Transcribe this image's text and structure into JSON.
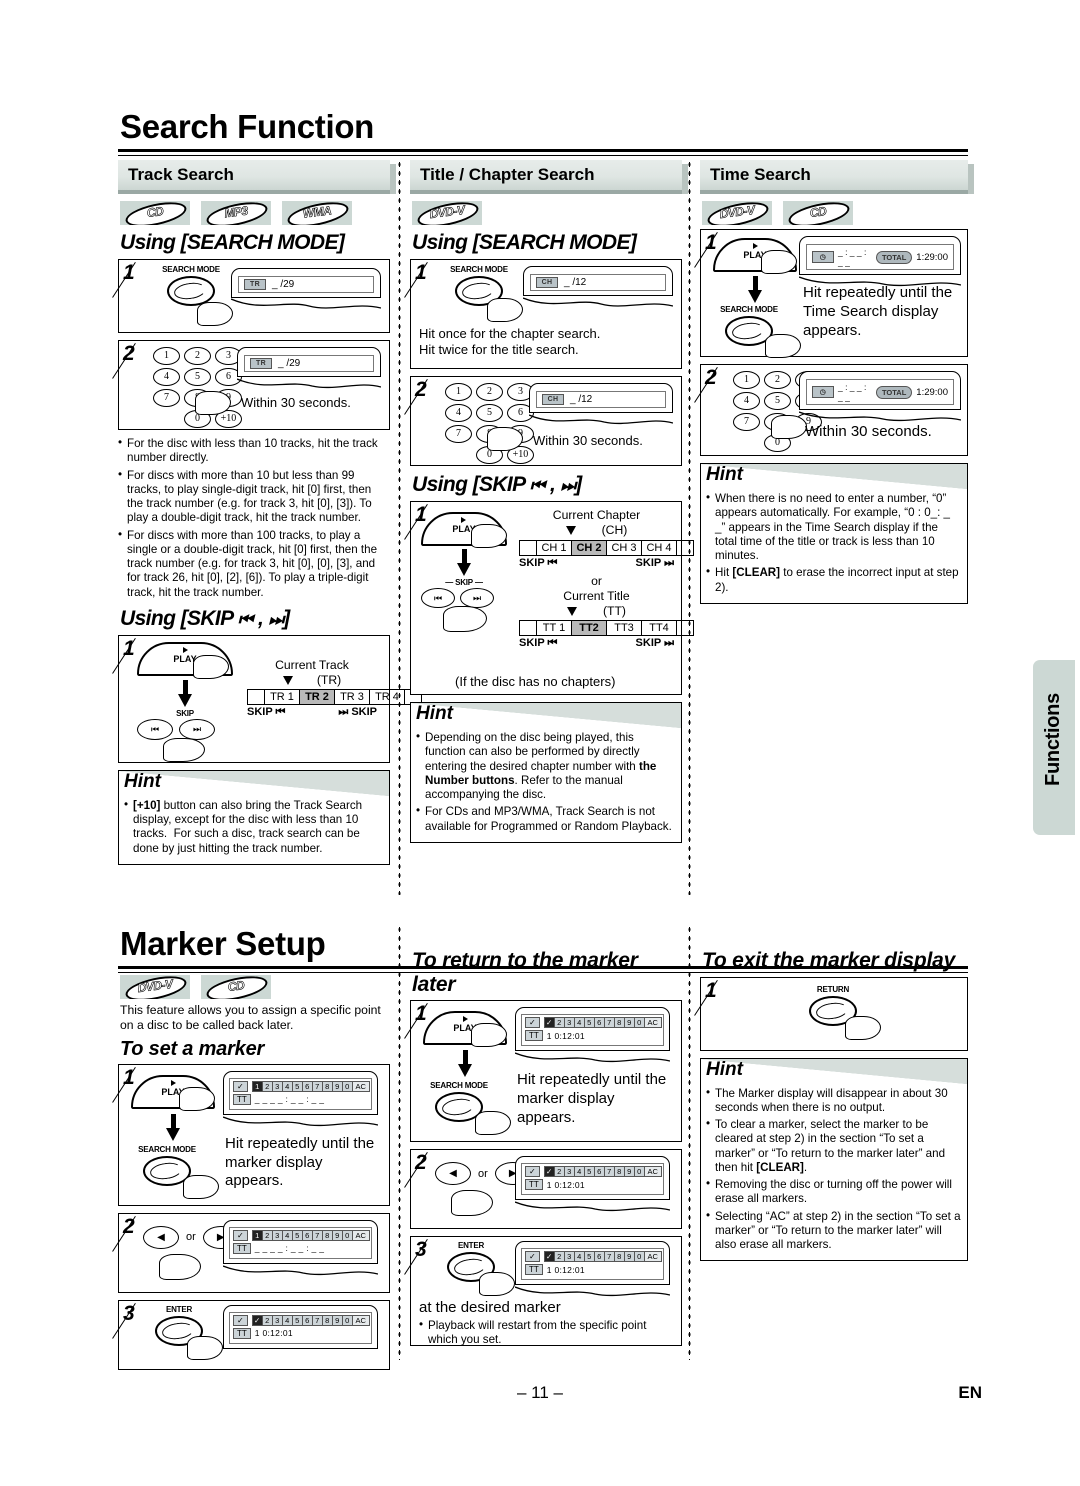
{
  "page": {
    "headings": {
      "search_function": "Search Function",
      "marker_setup": "Marker Setup"
    },
    "side_tab": "Functions",
    "footer": {
      "page_number": "– 11 –",
      "language": "EN"
    },
    "accent_color": "#ccd8d4",
    "rule_color": "#9aa8a4"
  },
  "track_search": {
    "title": "Track Search",
    "discs": [
      "CD",
      "MP3",
      "WMA"
    ],
    "using_search_mode": "Using [SEARCH MODE]",
    "using_skip": "Using [SKIP",
    "using_skip_end": "]",
    "step1": {
      "num": "1",
      "button": "SEARCH MODE",
      "display": {
        "tag": "TR",
        "value": "_ /29"
      }
    },
    "step2": {
      "num": "2",
      "keys": [
        "1",
        "2",
        "3",
        "4",
        "5",
        "6",
        "7",
        "8",
        "9",
        "0",
        "+10"
      ],
      "display": {
        "tag": "TR",
        "value": "_ /29"
      },
      "caption": "Within 30 seconds."
    },
    "notes": [
      "For the disc with less than 10 tracks, hit the track number directly.",
      "For discs with more than 10 but less than 99 tracks, to play single-digit track, hit [0] first, then the track number (e.g. for track 3, hit [0], [3]). To play a double-digit track, hit the track number.",
      "For discs with more than 100 tracks, to play a single or a double-digit track, hit [0] first, then the track number (e.g. for track 3, hit [0], [0], [3], and for track 26, hit [0], [2], [6]). To play a triple-digit track, hit the track number."
    ],
    "skip_step": {
      "num": "1",
      "play_label": "PLAY",
      "skip_label": "SKIP",
      "current_label": "Current Track",
      "current_unit": "(TR)",
      "segments": [
        "TR 1",
        "TR 2",
        "TR 3",
        "TR 4"
      ],
      "current_index": 1,
      "skip_prev": "SKIP",
      "skip_next": "SKIP"
    },
    "hint": {
      "title": "Hint",
      "items": [
        "[+10] button can also bring the Track Search display, except for the disc with less than 10 tracks.  For such a disc, track search can be done by just hitting the track number."
      ]
    }
  },
  "title_chapter_search": {
    "title": "Title / Chapter Search",
    "discs": [
      "DVD-V"
    ],
    "using_search_mode": "Using [SEARCH MODE]",
    "using_skip": "Using [SKIP",
    "step1": {
      "num": "1",
      "button": "SEARCH MODE",
      "display": {
        "tag": "CH",
        "value": "_ /12"
      },
      "caption_line1": "Hit once for the chapter search.",
      "caption_line2": "Hit twice for the title search."
    },
    "step2": {
      "num": "2",
      "keys": [
        "1",
        "2",
        "3",
        "4",
        "5",
        "6",
        "7",
        "8",
        "9",
        "0",
        "+10"
      ],
      "display": {
        "tag": "CH",
        "value": "_ /12"
      },
      "caption": "Within 30 seconds."
    },
    "skip_step": {
      "num": "1",
      "play_label": "PLAY",
      "skip_label": "SKIP",
      "current_chapter": "Current Chapter",
      "chapter_unit": "(CH)",
      "chapter_segments": [
        "CH 1",
        "CH 2",
        "CH 3",
        "CH 4"
      ],
      "or_label": "or",
      "current_title": "Current Title",
      "title_unit": "(TT)",
      "title_segments": [
        "TT 1",
        "TT2",
        "TT3",
        "TT4"
      ],
      "skip_prev": "SKIP",
      "skip_next": "SKIP",
      "footnote": "(If the disc has no chapters)"
    },
    "hint": {
      "title": "Hint",
      "items": [
        "Depending on the disc being played, this function can also be performed by directly entering the desired chapter number with the Number buttons. Refer to the manual accompanying the disc.",
        "For CDs and MP3/WMA, Track Search is not available for Programmed or Random Playback."
      ],
      "bold_phrase": "the Number buttons"
    }
  },
  "time_search": {
    "title": "Time Search",
    "discs": [
      "DVD-V",
      "CD"
    ],
    "step1": {
      "num": "1",
      "play_label": "PLAY",
      "button": "SEARCH MODE",
      "display": {
        "tag": "clock",
        "value": "_ : _ _ : _ _",
        "total_label": "TOTAL",
        "total_time": "1:29:00"
      },
      "caption": "Hit repeatedly until the Time Search display appears."
    },
    "step2": {
      "num": "2",
      "keys": [
        "1",
        "2",
        "3",
        "4",
        "5",
        "6",
        "7",
        "8",
        "9",
        "0"
      ],
      "display": {
        "tag": "clock",
        "value": "_ : _ _ : _ _",
        "total_label": "TOTAL",
        "total_time": "1:29:00"
      },
      "caption": "Within 30 seconds."
    },
    "hint": {
      "title": "Hint",
      "items": [
        "When there is no need to enter a number, “0” appears automatically. For example, “0 : 0_: _ _” appears in the Time Search display if the total time of the title or track is less than 10 minutes.",
        "Hit [CLEAR] to erase the incorrect input at step 2)."
      ]
    }
  },
  "marker_setup": {
    "discs": [
      "DVD-V",
      "CD"
    ],
    "intro": "This feature allows you to assign a specific point on a disc to be called back later.",
    "set_marker": {
      "heading": "To set a marker",
      "step1": {
        "num": "1",
        "play_label": "PLAY",
        "button": "SEARCH MODE",
        "display": {
          "cells": [
            "1",
            "2",
            "3",
            "4",
            "5",
            "6",
            "7",
            "8",
            "9",
            "0"
          ],
          "ac": "AC",
          "selected": 0,
          "row2_tag": "TT",
          "row2_value": "_ _  _ _ : _ _ : _ _"
        },
        "caption": "Hit repeatedly until the marker display appears."
      },
      "step2": {
        "num": "2",
        "or_label": "or",
        "display": {
          "cells": [
            "1",
            "2",
            "3",
            "4",
            "5",
            "6",
            "7",
            "8",
            "9",
            "0"
          ],
          "ac": "AC",
          "selected": 0,
          "row2_tag": "TT",
          "row2_value": "_ _  _ _ : _ _ : _ _"
        }
      },
      "step3": {
        "num": "3",
        "button": "ENTER",
        "display": {
          "cells": [
            "✓",
            "2",
            "3",
            "4",
            "5",
            "6",
            "7",
            "8",
            "9",
            "0"
          ],
          "ac": "AC",
          "selected": 0,
          "row2_tag": "TT",
          "row2_value": "1  0:12:01"
        }
      }
    },
    "return_marker": {
      "heading": "To return to the marker later",
      "step1": {
        "num": "1",
        "play_label": "PLAY",
        "button": "SEARCH MODE",
        "display": {
          "cells": [
            "✓",
            "2",
            "3",
            "4",
            "5",
            "6",
            "7",
            "8",
            "9",
            "0"
          ],
          "ac": "AC",
          "selected": 0,
          "row2_tag": "TT",
          "row2_value": "1  0:12:01"
        },
        "caption": "Hit repeatedly until the marker display appears."
      },
      "step2": {
        "num": "2",
        "or_label": "or",
        "display": {
          "cells": [
            "✓",
            "2",
            "3",
            "4",
            "5",
            "6",
            "7",
            "8",
            "9",
            "0"
          ],
          "ac": "AC",
          "selected": 0,
          "row2_tag": "TT",
          "row2_value": "1  0:12:01"
        }
      },
      "step3": {
        "num": "3",
        "button": "ENTER",
        "display": {
          "cells": [
            "✓",
            "2",
            "3",
            "4",
            "5",
            "6",
            "7",
            "8",
            "9",
            "0"
          ],
          "ac": "AC",
          "selected": 0,
          "row2_tag": "TT",
          "row2_value": "1  0:12:01"
        },
        "caption": "at the desired marker",
        "note": "Playback will restart from the specific point which you set."
      }
    },
    "exit_marker": {
      "heading": "To exit the marker display",
      "step1": {
        "num": "1",
        "button": "RETURN"
      },
      "hint": {
        "title": "Hint",
        "items": [
          "The Marker display will disappear in about 30 seconds when there is no output.",
          "To clear a marker, select the marker to be cleared at step 2) in the section “To set a marker” or “To return to the marker later” and then hit [CLEAR].",
          "Removing the disc or turning off the power will erase all markers.",
          "Selecting “AC” at step 2) in the section “To set a marker” or “To return to the marker later” will also erase all markers."
        ]
      }
    }
  }
}
